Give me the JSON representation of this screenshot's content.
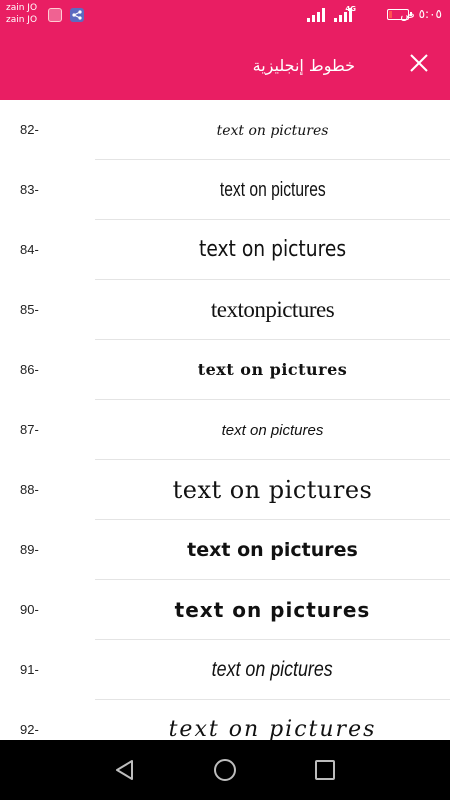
{
  "status_bar": {
    "carrier_1": "zain JO",
    "carrier_2": "zain JO",
    "network": "4G",
    "time": "٥:٠٥ ص"
  },
  "app_bar": {
    "title": "خطوط إنجليزية",
    "close_icon": "close-x-icon",
    "background_color": "#e91e63"
  },
  "fonts": {
    "sample_text": "text on pictures",
    "items": [
      {
        "number": "82-",
        "sample": "text on pictures"
      },
      {
        "number": "83-",
        "sample": "text on pictures"
      },
      {
        "number": "84-",
        "sample": "text on pictures"
      },
      {
        "number": "85-",
        "sample": "textonpictures"
      },
      {
        "number": "86-",
        "sample": "text on pictures"
      },
      {
        "number": "87-",
        "sample": "text on pictures"
      },
      {
        "number": "88-",
        "sample": "text on pictures"
      },
      {
        "number": "89-",
        "sample": "text on pictures"
      },
      {
        "number": "90-",
        "sample": "text on pictures"
      },
      {
        "number": "91-",
        "sample": "text on pictures"
      },
      {
        "number": "92-",
        "sample": "text on pictures"
      }
    ]
  },
  "nav_bar": {
    "back_icon": "triangle-back-icon",
    "home_icon": "circle-home-icon",
    "recent_icon": "square-recent-apps-icon"
  }
}
